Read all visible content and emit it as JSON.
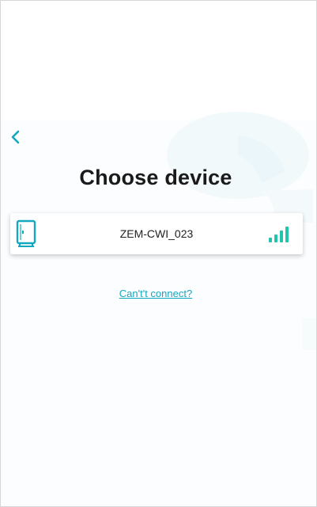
{
  "header": {
    "back_icon": "chevron-left-icon",
    "title": "Choose device"
  },
  "devices": [
    {
      "name": "ZEM-CWI_023",
      "icon": "device-icon",
      "signal_icon": "wifi-signal-icon",
      "signal_level": 1.0
    }
  ],
  "links": {
    "cant_connect": "Can't't connect?"
  },
  "colors": {
    "accent": "#14a8c0",
    "title": "#1a1a1a",
    "background": "#ffffff",
    "decoration": "#eef8fa"
  }
}
